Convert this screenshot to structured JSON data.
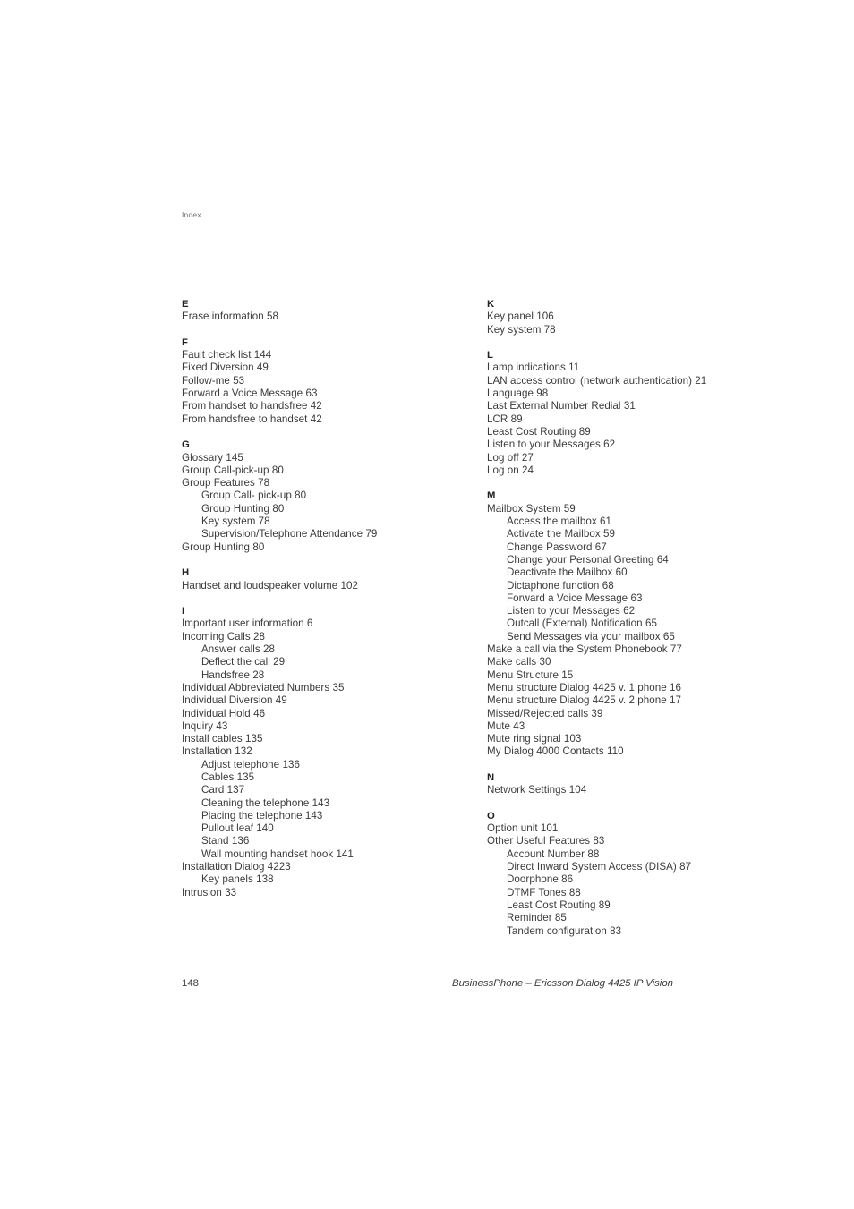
{
  "running_head": "Index",
  "footer": {
    "page_number": "148",
    "document_title": "BusinessPhone – Ericsson Dialog 4425 IP Vision"
  },
  "columns": [
    {
      "sections": [
        {
          "letter": "E",
          "entries": [
            {
              "text": "Erase information 58",
              "level": 0
            }
          ]
        },
        {
          "letter": "F",
          "entries": [
            {
              "text": "Fault check list 144",
              "level": 0
            },
            {
              "text": "Fixed Diversion 49",
              "level": 0
            },
            {
              "text": "Follow-me 53",
              "level": 0
            },
            {
              "text": "Forward a Voice Message 63",
              "level": 0
            },
            {
              "text": "From handset to handsfree 42",
              "level": 0
            },
            {
              "text": "From handsfree to handset 42",
              "level": 0
            }
          ]
        },
        {
          "letter": "G",
          "entries": [
            {
              "text": "Glossary 145",
              "level": 0
            },
            {
              "text": "Group Call-pick-up 80",
              "level": 0
            },
            {
              "text": "Group Features 78",
              "level": 0
            },
            {
              "text": "Group Call- pick-up 80",
              "level": 1
            },
            {
              "text": "Group Hunting 80",
              "level": 1
            },
            {
              "text": "Key system 78",
              "level": 1
            },
            {
              "text": "Supervision/Telephone Attendance 79",
              "level": 1
            },
            {
              "text": "Group Hunting 80",
              "level": 0
            }
          ]
        },
        {
          "letter": "H",
          "entries": [
            {
              "text": "Handset and loudspeaker volume 102",
              "level": 0
            }
          ]
        },
        {
          "letter": "I",
          "entries": [
            {
              "text": "Important user information 6",
              "level": 0
            },
            {
              "text": "Incoming Calls 28",
              "level": 0
            },
            {
              "text": "Answer calls 28",
              "level": 1
            },
            {
              "text": "Deflect the call 29",
              "level": 1
            },
            {
              "text": "Handsfree 28",
              "level": 1
            },
            {
              "text": "Individual Abbreviated Numbers 35",
              "level": 0
            },
            {
              "text": "Individual Diversion 49",
              "level": 0
            },
            {
              "text": "Individual Hold 46",
              "level": 0
            },
            {
              "text": "Inquiry 43",
              "level": 0
            },
            {
              "text": "Install cables 135",
              "level": 0
            },
            {
              "text": "Installation 132",
              "level": 0
            },
            {
              "text": "Adjust telephone 136",
              "level": 1
            },
            {
              "text": "Cables 135",
              "level": 1
            },
            {
              "text": "Card 137",
              "level": 1
            },
            {
              "text": "Cleaning the telephone 143",
              "level": 1
            },
            {
              "text": "Placing the telephone 143",
              "level": 1
            },
            {
              "text": "Pullout leaf 140",
              "level": 1
            },
            {
              "text": "Stand 136",
              "level": 1
            },
            {
              "text": "Wall mounting handset hook 141",
              "level": 1
            },
            {
              "text": "Installation Dialog 4223",
              "level": 0
            },
            {
              "text": "Key panels 138",
              "level": 1
            },
            {
              "text": "Intrusion 33",
              "level": 0
            }
          ]
        }
      ]
    },
    {
      "sections": [
        {
          "letter": "K",
          "entries": [
            {
              "text": "Key panel 106",
              "level": 0
            },
            {
              "text": "Key system 78",
              "level": 0
            }
          ]
        },
        {
          "letter": "L",
          "entries": [
            {
              "text": "Lamp indications 11",
              "level": 0
            },
            {
              "text": "LAN access control (network authentication) 21",
              "level": 0
            },
            {
              "text": "Language 98",
              "level": 0
            },
            {
              "text": "Last External Number Redial 31",
              "level": 0
            },
            {
              "text": "LCR 89",
              "level": 0
            },
            {
              "text": "Least Cost Routing 89",
              "level": 0
            },
            {
              "text": "Listen to your Messages 62",
              "level": 0
            },
            {
              "text": "Log off 27",
              "level": 0
            },
            {
              "text": "Log on 24",
              "level": 0
            }
          ]
        },
        {
          "letter": "M",
          "entries": [
            {
              "text": "Mailbox System 59",
              "level": 0
            },
            {
              "text": "Access the mailbox 61",
              "level": 1
            },
            {
              "text": "Activate the Mailbox 59",
              "level": 1
            },
            {
              "text": "Change Password 67",
              "level": 1
            },
            {
              "text": "Change your Personal Greeting 64",
              "level": 1
            },
            {
              "text": "Deactivate the Mailbox 60",
              "level": 1
            },
            {
              "text": "Dictaphone function 68",
              "level": 1
            },
            {
              "text": "Forward a Voice Message 63",
              "level": 1
            },
            {
              "text": "Listen to your Messages 62",
              "level": 1
            },
            {
              "text": "Outcall (External) Notification 65",
              "level": 1
            },
            {
              "text": "Send Messages via your mailbox 65",
              "level": 1
            },
            {
              "text": "Make a call via the System Phonebook 77",
              "level": 0
            },
            {
              "text": "Make calls 30",
              "level": 0
            },
            {
              "text": "Menu Structure 15",
              "level": 0
            },
            {
              "text": "Menu structure Dialog 4425 v. 1 phone 16",
              "level": 0
            },
            {
              "text": "Menu structure Dialog 4425 v. 2 phone 17",
              "level": 0
            },
            {
              "text": "Missed/Rejected calls 39",
              "level": 0
            },
            {
              "text": "Mute 43",
              "level": 0
            },
            {
              "text": "Mute ring signal 103",
              "level": 0
            },
            {
              "text": "My Dialog 4000 Contacts 110",
              "level": 0
            }
          ]
        },
        {
          "letter": "N",
          "entries": [
            {
              "text": "Network Settings 104",
              "level": 0
            }
          ]
        },
        {
          "letter": "O",
          "entries": [
            {
              "text": "Option unit 101",
              "level": 0
            },
            {
              "text": "Other Useful Features 83",
              "level": 0
            },
            {
              "text": "Account Number 88",
              "level": 1
            },
            {
              "text": "Direct Inward System Access (DISA) 87",
              "level": 1
            },
            {
              "text": "Doorphone 86",
              "level": 1
            },
            {
              "text": "DTMF Tones 88",
              "level": 1
            },
            {
              "text": "Least Cost Routing 89",
              "level": 1
            },
            {
              "text": "Reminder 85",
              "level": 1
            },
            {
              "text": "Tandem configuration 83",
              "level": 1
            }
          ]
        }
      ]
    }
  ]
}
